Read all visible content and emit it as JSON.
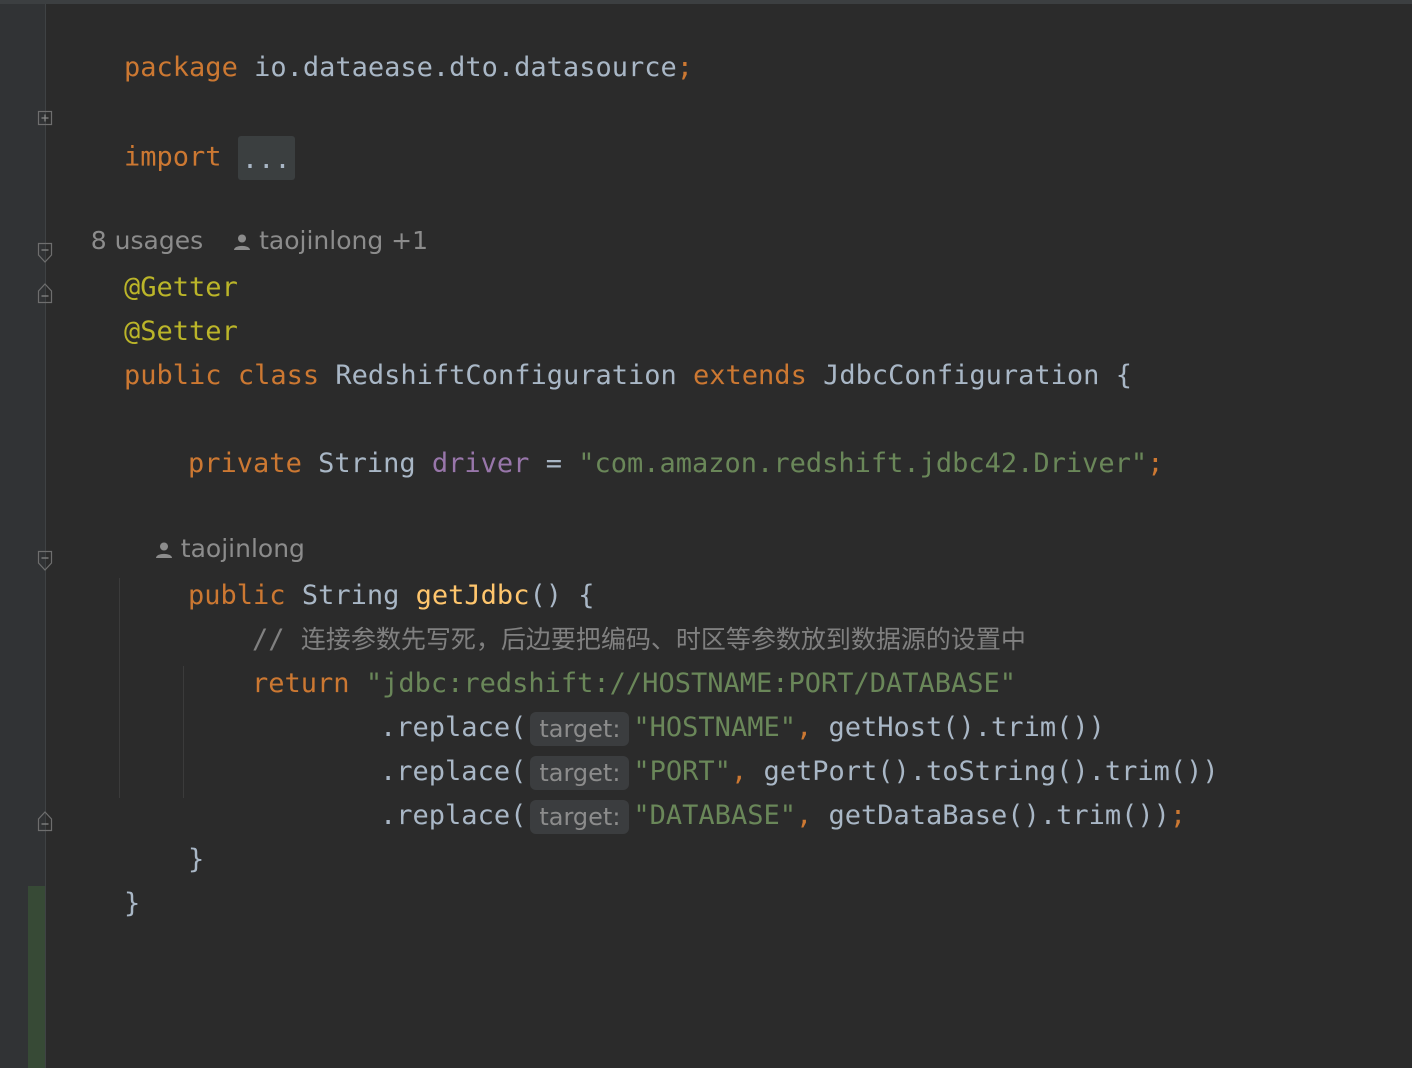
{
  "colors": {
    "background": "#2b2b2b",
    "gutter": "#313335",
    "keyword": "#cc7832",
    "annotation": "#bbb529",
    "string": "#6a8759",
    "field": "#9876aa",
    "method": "#ffc66d",
    "comment": "#808080",
    "text": "#a9b7c6",
    "change_marker": "#374a36"
  },
  "icons": {
    "fold": "fold-icon",
    "person": "person-icon"
  },
  "code": {
    "package_kw": "package",
    "package_name": " io.dataease.dto.datasource",
    "semicolon": ";",
    "import_kw": "import",
    "import_collapsed": "...",
    "usages_hint": "8 usages",
    "class_author_hint": "taojinlong +1",
    "annotation_getter": "@Getter",
    "annotation_setter": "@Setter",
    "public_kw": "public",
    "class_kw": "class",
    "class_name": "RedshiftConfiguration",
    "extends_kw": "extends",
    "parent_class": "JdbcConfiguration",
    "open_brace": "{",
    "private_kw": "private",
    "string_type": "String",
    "field_name": "driver",
    "equals": "=",
    "driver_value": "\"com.amazon.redshift.jdbc42.Driver\"",
    "method_author_hint": "taojinlong",
    "method_name": "getJdbc",
    "parens": "()",
    "comment_prefix": "//",
    "comment_text": "连接参数先写死，后边要把编码、时区等参数放到数据源的设置中",
    "return_kw": "return",
    "jdbc_url": "\"jdbc:redshift://HOSTNAME:PORT/DATABASE\"",
    "replace_call": ".replace(",
    "param_hint": "target:",
    "arg_hostname": "\"HOSTNAME\"",
    "arg_port": "\"PORT\"",
    "arg_database": "\"DATABASE\"",
    "comma": ",",
    "call_host": "getHost().trim())",
    "call_port": "getPort().toString().trim())",
    "call_database": "getDataBase().trim())",
    "close_brace": "}"
  }
}
